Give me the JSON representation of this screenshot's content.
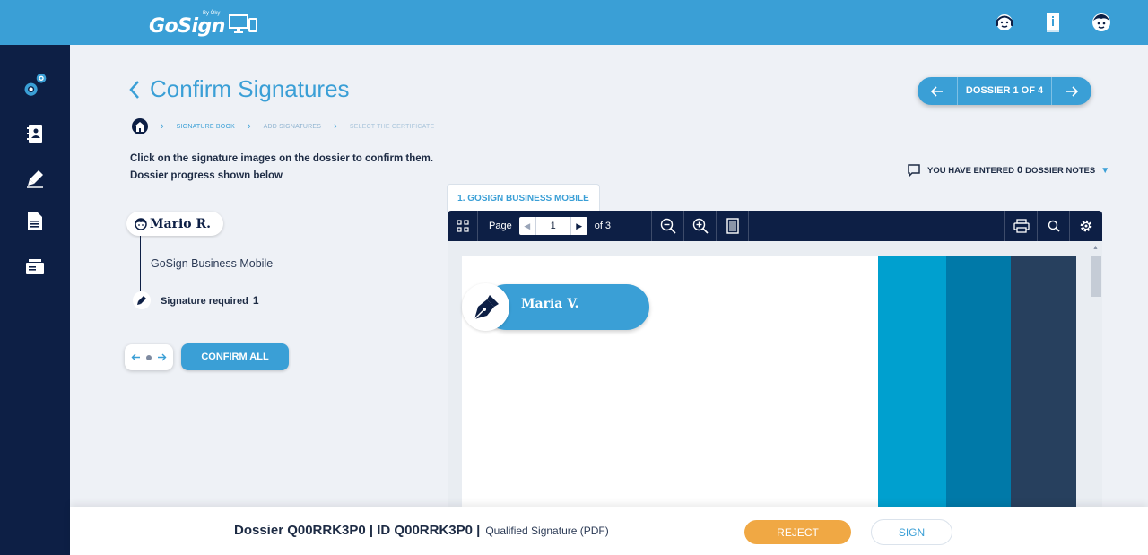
{
  "app": {
    "logo_text": "GoSign",
    "logo_by": "By Öky"
  },
  "topbar": {
    "icons": [
      "support-agent-icon",
      "info-book-icon",
      "user-avatar-icon"
    ]
  },
  "sidebar": {
    "items": [
      "settings-gears-icon",
      "contacts-book-icon",
      "signature-pen-icon",
      "document-icon",
      "archive-icon"
    ]
  },
  "header": {
    "title": "Confirm Signatures",
    "dossier_nav_label": "DOSSIER 1 OF 4"
  },
  "breadcrumb": {
    "items": [
      "SIGNATURE BOOK",
      "ADD SIGNATURES",
      "SELECT THE CERTIFICATE"
    ]
  },
  "instructions": {
    "line1": "Click on the signature images on the dossier to confirm them.",
    "line2": "Dossier progress shown below"
  },
  "notes": {
    "prefix": "YOU HAVE ENTERED",
    "count": "0",
    "suffix": "DOSSIER NOTES"
  },
  "signer": {
    "name": "Mario R.",
    "document": "GoSign Business Mobile",
    "requirement_label": "Signature required",
    "requirement_count": "1"
  },
  "actions": {
    "confirm_all": "CONFIRM ALL"
  },
  "viewer": {
    "tab_label": "1. GOSIGN BUSINESS MOBILE",
    "page_label": "Page",
    "page_value": "1",
    "page_total": "of 3"
  },
  "document_page": {
    "signature_name": "Maria V.",
    "stripe_colors": [
      "#00a0cf",
      "#0079a8",
      "#27405e"
    ]
  },
  "bottom": {
    "dossier_text": "Dossier Q00RRK3P0 | ID Q00RRK3P0 |",
    "signature_type": "Qualified Signature (PDF)",
    "reject": "REJECT",
    "sign": "SIGN"
  },
  "colors": {
    "primary": "#3a9fd6",
    "navy": "#0d1f45",
    "reject": "#f0a844",
    "background": "#eef1f6"
  }
}
